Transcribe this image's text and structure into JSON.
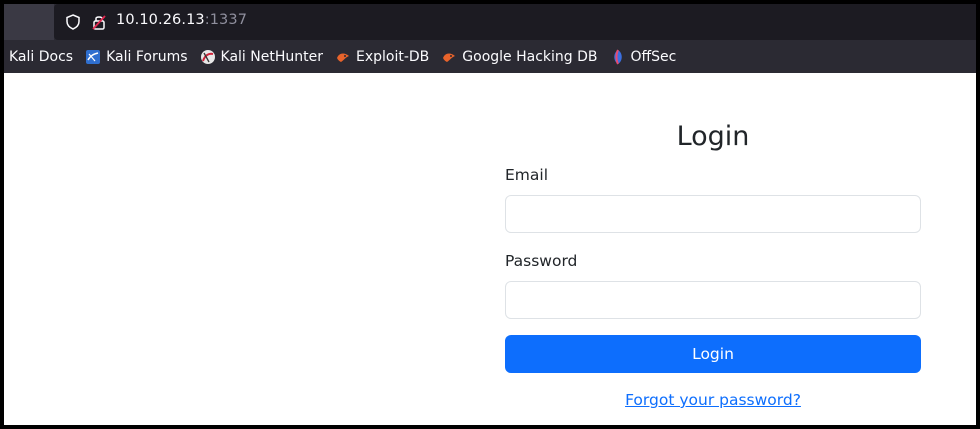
{
  "browser": {
    "url_host": "10.10.26.13",
    "url_port": ":1337",
    "bookmarks": [
      {
        "label": "Kali Docs",
        "icon": "none"
      },
      {
        "label": "Kali Forums",
        "icon": "kali-forums-icon"
      },
      {
        "label": "Kali NetHunter",
        "icon": "kali-nethunter-icon"
      },
      {
        "label": "Exploit-DB",
        "icon": "exploit-db-icon"
      },
      {
        "label": "Google Hacking DB",
        "icon": "exploit-db-icon"
      },
      {
        "label": "OffSec",
        "icon": "offsec-icon"
      }
    ]
  },
  "login": {
    "title": "Login",
    "email_label": "Email",
    "email_value": "",
    "password_label": "Password",
    "password_value": "",
    "submit_label": "Login",
    "forgot_link": "Forgot your password?"
  },
  "colors": {
    "primary": "#0d6efd",
    "toolbar": "#2b2a33",
    "urlbar": "#1c1b22"
  }
}
